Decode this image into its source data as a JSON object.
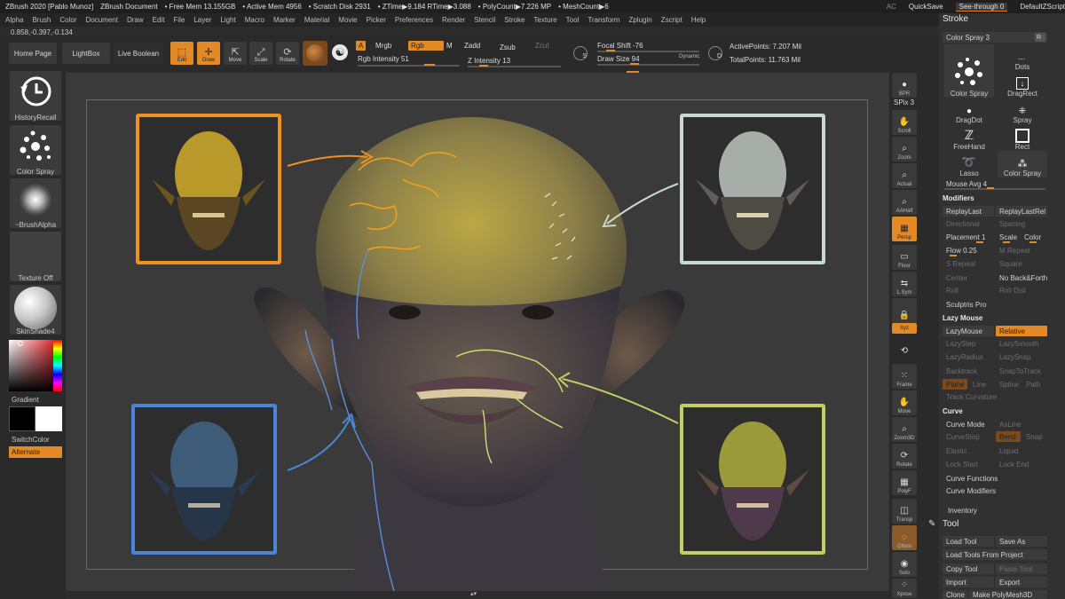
{
  "titlebar": {
    "app": "ZBrush 2020 [Pablo Munoz]",
    "doc": "ZBrush Document",
    "free_mem": "• Free Mem 13.155GB",
    "active_mem": "• Active Mem 4956",
    "scratch": "• Scratch Disk 2931",
    "ztime": "• ZTime▶9.184 RTime▶3.088",
    "polycount": "• PolyCount▶7.226 MP",
    "meshcount": "• MeshCount▶6",
    "ac": "AC",
    "quicksave": "QuickSave",
    "seethrough": "See-through  0",
    "zscript": "DefaultZScript"
  },
  "menu": [
    "Alpha",
    "Brush",
    "Color",
    "Document",
    "Draw",
    "Edit",
    "File",
    "Layer",
    "Light",
    "Macro",
    "Marker",
    "Material",
    "Movie",
    "Picker",
    "Preferences",
    "Render",
    "Stencil",
    "Stroke",
    "Texture",
    "Tool",
    "Transform",
    "Zplugin",
    "Zscript",
    "Help"
  ],
  "coords": "0.858,-0.397,-0.134",
  "topshelf": {
    "home": "Home Page",
    "lightbox": "LightBox",
    "liveboolean": "Live Boolean",
    "edit": "Edit",
    "draw": "Draw",
    "move": "Move",
    "scale": "Scale",
    "rotate": "Rotate",
    "a": "A",
    "mrgb": "Mrgb",
    "rgb": "Rgb",
    "m": "M",
    "zadd": "Zadd",
    "zsub": "Zsub",
    "zcut": "Zcut",
    "rgb_intensity": "Rgb Intensity 51",
    "z_intensity": "Z Intensity 13",
    "focal_shift": "Focal Shift -76",
    "draw_size": "Draw Size 94",
    "dynamic": "Dynamic",
    "active_points": "ActivePoints: 7.207 Mil",
    "total_points": "TotalPoints: 11.763 Mil"
  },
  "leftshelf": {
    "history": "HistoryRecall",
    "colorspray": "Color Spray",
    "brushalpha": "~BrushAlpha",
    "texture": "Texture Off",
    "material": "SkinShade4",
    "gradient": "Gradient",
    "switchcolor": "SwitchColor",
    "alternate": "Alternate"
  },
  "rightshelf": {
    "bpr": "BPR",
    "spix": "SPix 3",
    "scroll": "Scroll",
    "zoom": "Zoom",
    "actual": "Actual",
    "aahalf": "AAHalf",
    "persp": "Persp",
    "floor": "Floor",
    "lsym": "L.Sym",
    "frame": "Frame",
    "move": "Move",
    "zoom3d": "Zoom3D",
    "rotate": "Rotate",
    "polyf": "PolyF",
    "transp": "Transp",
    "ghost": "Ghost",
    "solo": "Solo",
    "xpose": "Xpose",
    "xyz": "Xyz"
  },
  "stroke": {
    "title": "Stroke",
    "colorspray": "Color Spray  3",
    "r": "R",
    "types": [
      "Color Spray",
      "Dots",
      "DragRect",
      "DragDot",
      "Spray",
      "FreeHand",
      "Rect",
      "Lasso",
      "Color Spray"
    ],
    "mouse_avg": "Mouse Avg 4",
    "modifiers": "Modifiers",
    "replaylast": "ReplayLast",
    "replaylastrel": "ReplayLastRel",
    "directional": "Directional",
    "spacing": "Spacing",
    "placement": "Placement 1",
    "scale": "Scale",
    "color": "Color",
    "flow": "Flow 0.25",
    "mrepeat": "M Repeat",
    "srepeat": "S Repeat",
    "square": "Square",
    "center": "Center",
    "nobackforth": "No Back&Forth",
    "roll": "Roll",
    "rolldist": "Roll Dist",
    "sculptris": "Sculptris Pro",
    "lazymouse_title": "Lazy Mouse",
    "lazymouse": "LazyMouse",
    "relative": "Relative",
    "lazystep": "LazyStep",
    "lazysmooth": "LazySmooth",
    "lazyradius": "LazyRadius",
    "lazysnap": "LazySnap",
    "backtrack": "Backtrack",
    "snaptotrack": "SnapToTrack",
    "plane": "Plane",
    "line": "Line",
    "spline": "Spline",
    "path": "Path",
    "trackcurvature": "Track Curvature",
    "curve_title": "Curve",
    "curvemode": "Curve Mode",
    "asline": "AsLine",
    "curvestep": "CurveStep",
    "bend": "Bend",
    "snap": "Snap",
    "elastic": "Elastic",
    "liquid": "Liquid",
    "lockstart": "Lock Start",
    "lockend": "Lock End",
    "curvefunctions": "Curve Functions",
    "curvemodifiers": "Curve Modifiers"
  },
  "tool": {
    "inventory": "Inventory",
    "title": "Tool",
    "loadtool": "Load Tool",
    "saveas": "Save As",
    "loadfromproject": "Load Tools From Project",
    "copytool": "Copy Tool",
    "pastetool": "Paste Tool",
    "import": "Import",
    "export": "Export",
    "clone": "Clone",
    "makepolymesh": "Make PolyMesh3D"
  },
  "colors": {
    "accent": "#e38a27",
    "thumb_orange": "#f0901e",
    "thumb_white": "#c8d8d2",
    "thumb_blue": "#4a86d8",
    "thumb_green": "#c4cf63"
  }
}
